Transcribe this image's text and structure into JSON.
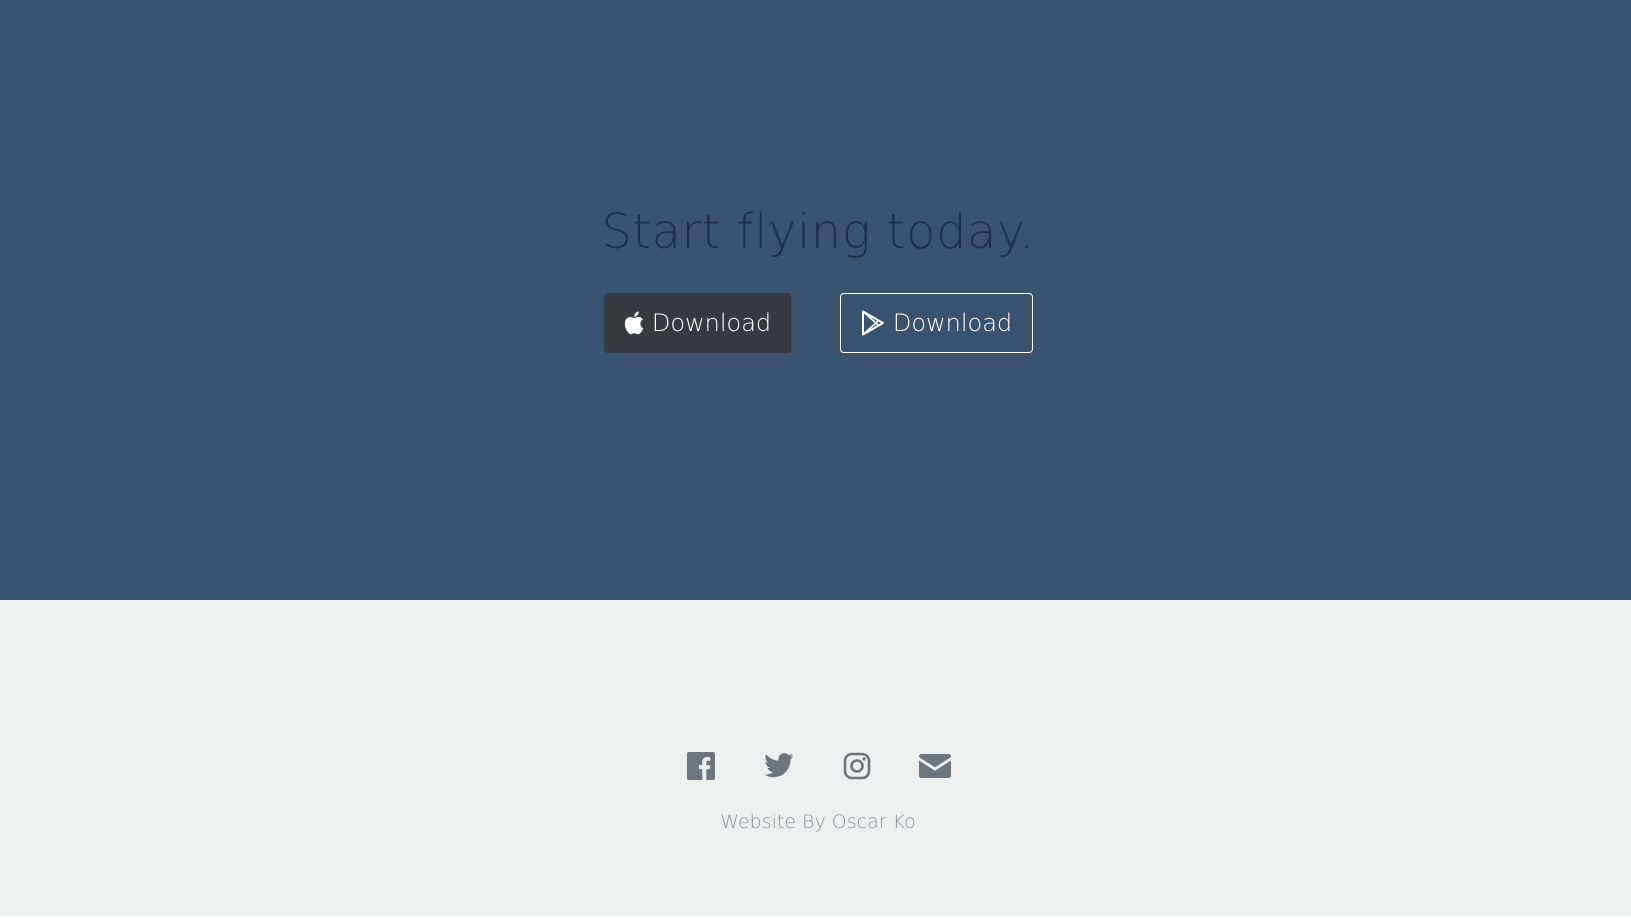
{
  "cta": {
    "title": "Start flying today.",
    "background": "#39536f",
    "buttons": [
      {
        "label": "Download",
        "icon": "apple-icon",
        "style": "dark"
      },
      {
        "label": "Download",
        "icon": "google-play-icon",
        "style": "outline"
      }
    ]
  },
  "footer": {
    "social_icons": [
      "facebook-icon",
      "twitter-icon",
      "instagram-icon",
      "envelope-icon"
    ],
    "credit": "Website By Oscar Ko",
    "background": "#ecf0f1"
  }
}
